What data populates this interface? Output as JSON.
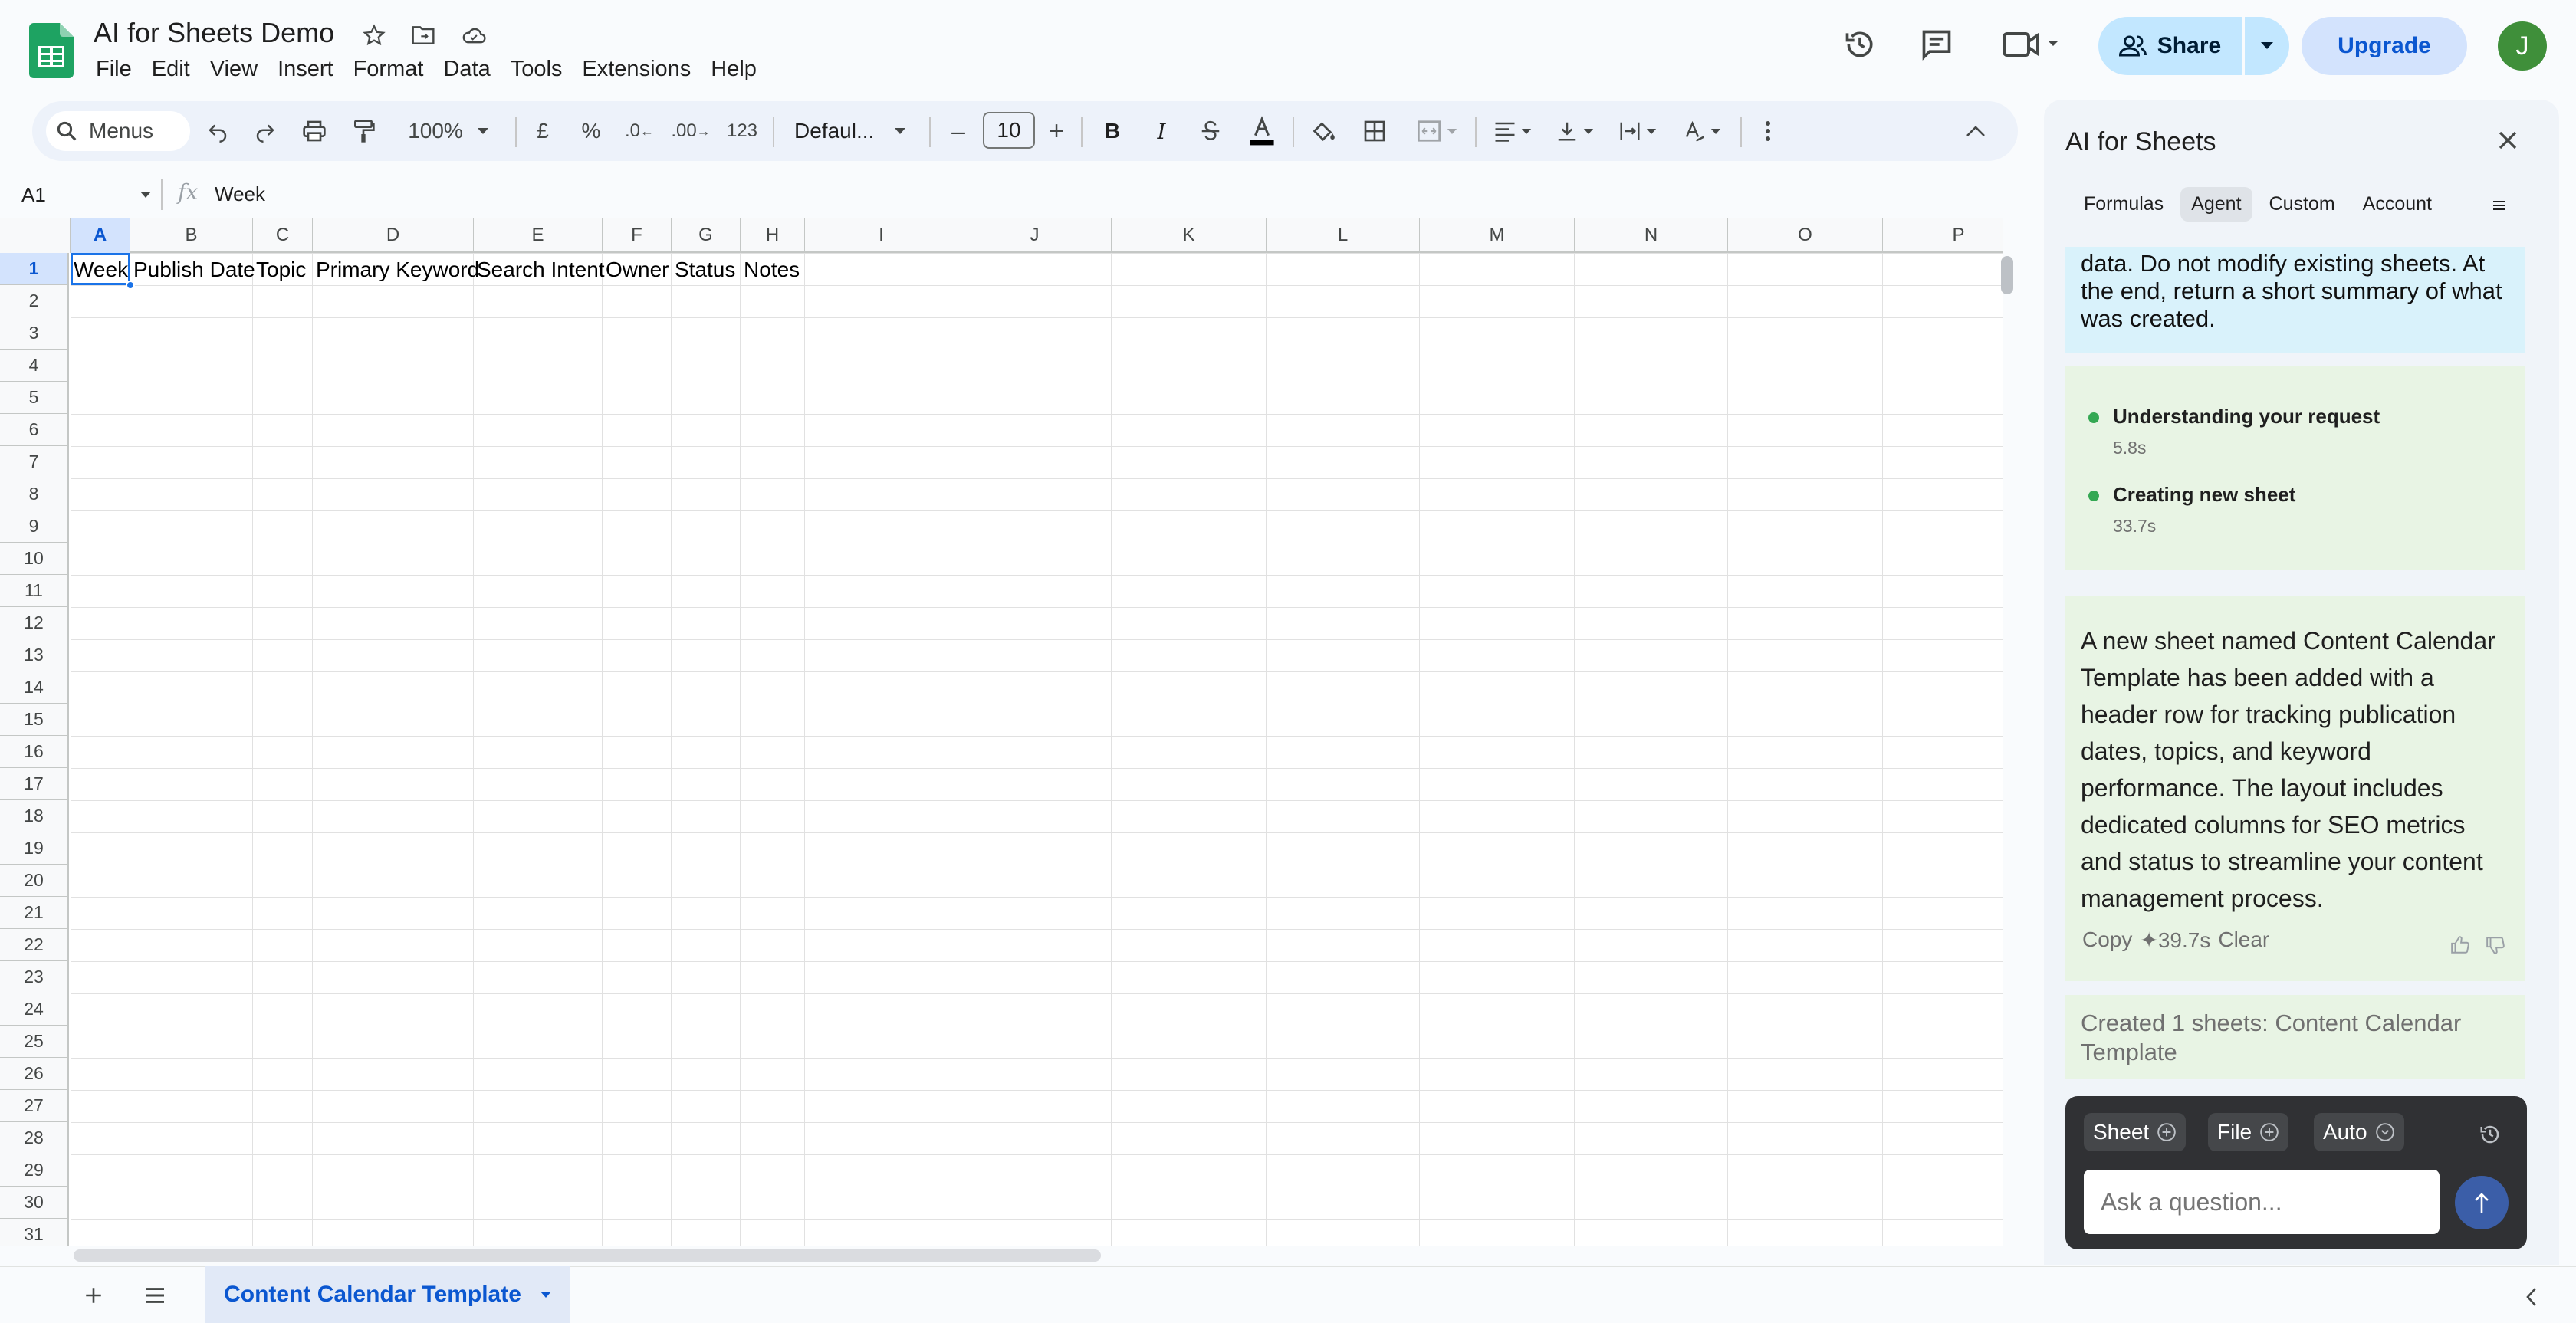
{
  "app": {
    "doc_title": "AI for Sheets Demo",
    "menus": [
      "File",
      "Edit",
      "View",
      "Insert",
      "Format",
      "Data",
      "Tools",
      "Extensions",
      "Help"
    ],
    "share_label": "Share",
    "upgrade_label": "Upgrade",
    "avatar_initial": "J"
  },
  "toolbar": {
    "menus_search": "Menus",
    "zoom": "100%",
    "currency": "£",
    "percent": "%",
    "dec_decrease": ".0",
    "dec_increase": ".00",
    "number_format": "123",
    "font": "Defaul...",
    "font_size": "10",
    "minus": "–",
    "plus": "+",
    "bold": "B",
    "italic": "I"
  },
  "formula_bar": {
    "cell_ref": "A1",
    "fx": "fx",
    "content": "Week"
  },
  "grid": {
    "columns": [
      "A",
      "B",
      "C",
      "D",
      "E",
      "F",
      "G",
      "H",
      "I",
      "J",
      "K",
      "L",
      "M",
      "N",
      "O",
      "P"
    ],
    "rows": [
      "1",
      "2",
      "3",
      "4",
      "5",
      "6",
      "7",
      "8",
      "9",
      "10",
      "11",
      "12",
      "13",
      "14",
      "15",
      "16",
      "17",
      "18",
      "19",
      "20",
      "21",
      "22",
      "23",
      "24",
      "25",
      "26",
      "27",
      "28",
      "29",
      "30",
      "31"
    ],
    "header_row": [
      "Week",
      "Publish Date",
      "Topic",
      "Primary Keyword",
      "Search Intent",
      "Owner",
      "Status",
      "Notes"
    ],
    "selected_cell": "A1"
  },
  "sheet_tab": {
    "label": "Content Calendar Template"
  },
  "panel": {
    "title": "AI for Sheets",
    "tabs": [
      "Formulas",
      "Agent",
      "Custom",
      "Account"
    ],
    "active_tab": "Agent",
    "user_message": "data. Do not modify existing sheets. At the end, return a short summary of what was created.",
    "steps": [
      {
        "title": "Understanding your request",
        "time": "5.8s"
      },
      {
        "title": "Creating new sheet",
        "time": "33.7s"
      }
    ],
    "reply": "A new sheet named Content Calendar Template has been added with a header row for tracking publication dates, topics, and keyword performance. The layout includes dedicated columns for SEO metrics and status to streamline your content management process.",
    "reply_actions": {
      "copy": "Copy",
      "time": "✦39.7s",
      "clear": "Clear"
    },
    "summary": "Created 1 sheets: Content Calendar Template",
    "chips": [
      "Sheet",
      "File",
      "Auto"
    ],
    "input_placeholder": "Ask a question..."
  },
  "colors": {
    "accent": "#0b57d0",
    "share_bg": "#c2e7ff",
    "panel_bg": "#f0f4f9",
    "composer_bg": "#303134",
    "status_dot": "#34a853"
  }
}
